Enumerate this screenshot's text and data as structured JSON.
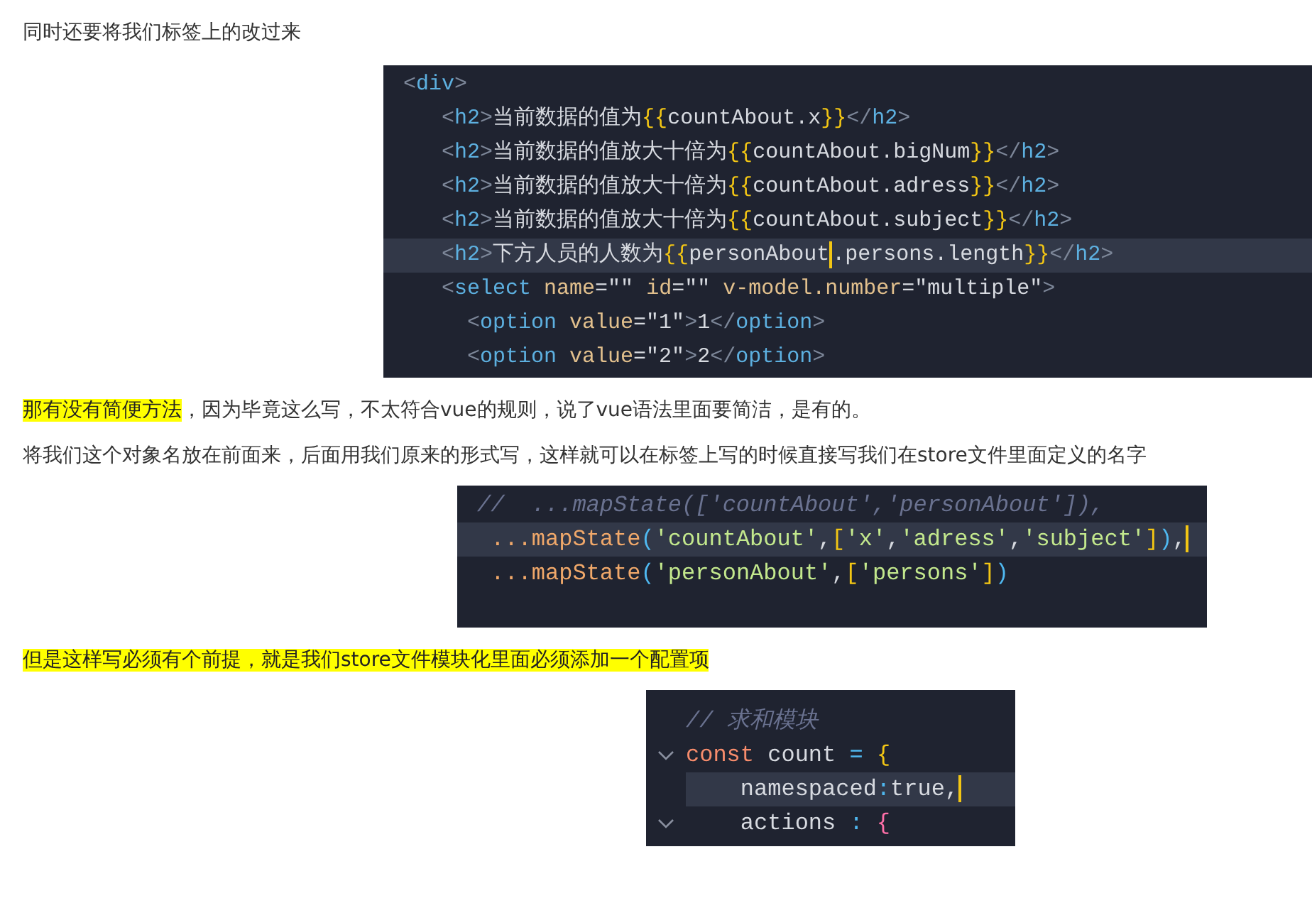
{
  "blocks": [
    {
      "kind": "paragraph",
      "segments": [
        {
          "text": "同时还要将我们标签上的改过来",
          "highlight": false
        }
      ]
    },
    {
      "kind": "code",
      "lines": [
        {
          "current": false,
          "tokens": [
            {
              "t": "<",
              "kind": "punct"
            },
            {
              "t": "div",
              "kind": "tag"
            },
            {
              "t": ">",
              "kind": "punct"
            }
          ]
        },
        {
          "current": false,
          "tokens": [
            {
              "t": "   <",
              "kind": "punct"
            },
            {
              "t": "h2",
              "kind": "tag"
            },
            {
              "t": ">",
              "kind": "punct"
            },
            {
              "t": "当前数据的值为",
              "kind": "text"
            },
            {
              "t": "{{",
              "kind": "brace"
            },
            {
              "t": "countAbout.x",
              "kind": "text"
            },
            {
              "t": "}}",
              "kind": "brace"
            },
            {
              "t": "</",
              "kind": "punct"
            },
            {
              "t": "h2",
              "kind": "tag"
            },
            {
              "t": ">",
              "kind": "punct"
            }
          ]
        },
        {
          "current": false,
          "tokens": [
            {
              "t": "   <",
              "kind": "punct"
            },
            {
              "t": "h2",
              "kind": "tag"
            },
            {
              "t": ">",
              "kind": "punct"
            },
            {
              "t": "当前数据的值放大十倍为",
              "kind": "text"
            },
            {
              "t": "{{",
              "kind": "brace"
            },
            {
              "t": "countAbout.bigNum",
              "kind": "text"
            },
            {
              "t": "}}",
              "kind": "brace"
            },
            {
              "t": "</",
              "kind": "punct"
            },
            {
              "t": "h2",
              "kind": "tag"
            },
            {
              "t": ">",
              "kind": "punct"
            }
          ]
        },
        {
          "current": false,
          "tokens": [
            {
              "t": "   <",
              "kind": "punct"
            },
            {
              "t": "h2",
              "kind": "tag"
            },
            {
              "t": ">",
              "kind": "punct"
            },
            {
              "t": "当前数据的值放大十倍为",
              "kind": "text"
            },
            {
              "t": "{{",
              "kind": "brace"
            },
            {
              "t": "countAbout.adress",
              "kind": "text"
            },
            {
              "t": "}}",
              "kind": "brace"
            },
            {
              "t": "</",
              "kind": "punct"
            },
            {
              "t": "h2",
              "kind": "tag"
            },
            {
              "t": ">",
              "kind": "punct"
            }
          ]
        },
        {
          "current": false,
          "tokens": [
            {
              "t": "   <",
              "kind": "punct"
            },
            {
              "t": "h2",
              "kind": "tag"
            },
            {
              "t": ">",
              "kind": "punct"
            },
            {
              "t": "当前数据的值放大十倍为",
              "kind": "text"
            },
            {
              "t": "{{",
              "kind": "brace"
            },
            {
              "t": "countAbout.subject",
              "kind": "text"
            },
            {
              "t": "}}",
              "kind": "brace"
            },
            {
              "t": "</",
              "kind": "punct"
            },
            {
              "t": "h2",
              "kind": "tag"
            },
            {
              "t": ">",
              "kind": "punct"
            }
          ]
        },
        {
          "current": true,
          "tokens": [
            {
              "t": "   <",
              "kind": "punct"
            },
            {
              "t": "h2",
              "kind": "tag"
            },
            {
              "t": ">",
              "kind": "punct"
            },
            {
              "t": "下方人员的人数为",
              "kind": "text"
            },
            {
              "t": "{{",
              "kind": "brace"
            },
            {
              "t": "personAbout",
              "kind": "text"
            },
            {
              "kind": "cursor"
            },
            {
              "t": ".persons.length",
              "kind": "text"
            },
            {
              "t": "}}",
              "kind": "brace"
            },
            {
              "t": "</",
              "kind": "punct"
            },
            {
              "t": "h2",
              "kind": "tag"
            },
            {
              "t": ">",
              "kind": "punct"
            }
          ]
        },
        {
          "current": false,
          "tokens": [
            {
              "t": "   <",
              "kind": "punct"
            },
            {
              "t": "select",
              "kind": "tag"
            },
            {
              "t": " name",
              "kind": "attr"
            },
            {
              "t": "=\"\"",
              "kind": "text"
            },
            {
              "t": " id",
              "kind": "attr"
            },
            {
              "t": "=\"\"",
              "kind": "text"
            },
            {
              "t": " v-model.number",
              "kind": "attr"
            },
            {
              "t": "=\"multiple\"",
              "kind": "text"
            },
            {
              "t": ">",
              "kind": "punct"
            }
          ]
        },
        {
          "current": false,
          "tokens": [
            {
              "t": "     <",
              "kind": "punct"
            },
            {
              "t": "option",
              "kind": "tag"
            },
            {
              "t": " value",
              "kind": "attr"
            },
            {
              "t": "=\"1\"",
              "kind": "text"
            },
            {
              "t": ">",
              "kind": "punct"
            },
            {
              "t": "1",
              "kind": "text"
            },
            {
              "t": "</",
              "kind": "punct"
            },
            {
              "t": "option",
              "kind": "tag"
            },
            {
              "t": ">",
              "kind": "punct"
            }
          ]
        },
        {
          "current": false,
          "tokens": [
            {
              "t": "     <",
              "kind": "punct"
            },
            {
              "t": "option",
              "kind": "tag"
            },
            {
              "t": " value",
              "kind": "attr"
            },
            {
              "t": "=\"2\"",
              "kind": "text"
            },
            {
              "t": ">",
              "kind": "punct"
            },
            {
              "t": "2",
              "kind": "text"
            },
            {
              "t": "</",
              "kind": "punct"
            },
            {
              "t": "option",
              "kind": "tag"
            },
            {
              "t": ">",
              "kind": "punct"
            }
          ]
        }
      ]
    },
    {
      "kind": "paragraph",
      "segments": [
        {
          "text": "那有没有简便方法",
          "highlight": true
        },
        {
          "text": "，因为毕竟这么写，不太符合vue的规则，说了vue语法里面要简洁，是有的。",
          "highlight": false
        }
      ]
    },
    {
      "kind": "paragraph",
      "segments": [
        {
          "text": "将我们这个对象名放在前面来，后面用我们原来的形式写，这样就可以在标签上写的时候直接写我们在store文件里面定义的名字",
          "highlight": false
        }
      ]
    },
    {
      "kind": "code",
      "lines": [
        {
          "current": false,
          "tokens": [
            {
              "t": "//  ...mapState(['countAbout','personAbout']),",
              "kind": "comment"
            }
          ]
        },
        {
          "current": true,
          "tokens": [
            {
              "t": " ...mapState",
              "kind": "fn"
            },
            {
              "t": "(",
              "kind": "paren"
            },
            {
              "t": "'countAbout'",
              "kind": "str"
            },
            {
              "t": ",",
              "kind": "text"
            },
            {
              "t": "[",
              "kind": "brace"
            },
            {
              "t": "'x'",
              "kind": "str"
            },
            {
              "t": ",",
              "kind": "text"
            },
            {
              "t": "'adress'",
              "kind": "str"
            },
            {
              "t": ",",
              "kind": "text"
            },
            {
              "t": "'subject'",
              "kind": "str"
            },
            {
              "t": "]",
              "kind": "brace"
            },
            {
              "t": ")",
              "kind": "paren"
            },
            {
              "t": ",",
              "kind": "text"
            },
            {
              "kind": "cursor"
            }
          ]
        },
        {
          "current": false,
          "tokens": [
            {
              "t": " ...mapState",
              "kind": "fn"
            },
            {
              "t": "(",
              "kind": "paren"
            },
            {
              "t": "'personAbout'",
              "kind": "str"
            },
            {
              "t": ",",
              "kind": "text"
            },
            {
              "t": "[",
              "kind": "brace"
            },
            {
              "t": "'persons'",
              "kind": "str"
            },
            {
              "t": "]",
              "kind": "brace"
            },
            {
              "t": ")",
              "kind": "paren"
            }
          ]
        }
      ]
    },
    {
      "kind": "paragraph",
      "segments": [
        {
          "text": "但是这样写必须有个前提，就是我们store文件模块化里面必须添加一个配置项",
          "highlight": true
        }
      ]
    },
    {
      "kind": "code",
      "lines": [
        {
          "current": false,
          "fold": false,
          "tokens": [
            {
              "t": "// 求和模块",
              "kind": "comment"
            }
          ]
        },
        {
          "current": false,
          "fold": true,
          "tokens": [
            {
              "t": "const",
              "kind": "keyword"
            },
            {
              "t": " count ",
              "kind": "text"
            },
            {
              "t": "=",
              "kind": "paren"
            },
            {
              "t": " {",
              "kind": "brace"
            }
          ]
        },
        {
          "current": true,
          "fold": false,
          "tokens": [
            {
              "t": "    namespaced",
              "kind": "text"
            },
            {
              "t": ":",
              "kind": "paren"
            },
            {
              "t": "true,",
              "kind": "text"
            },
            {
              "kind": "cursor"
            }
          ]
        },
        {
          "current": false,
          "fold": true,
          "tokens": [
            {
              "t": "    actions ",
              "kind": "text"
            },
            {
              "t": ":",
              "kind": "paren"
            },
            {
              "t": " {",
              "kind": "bool"
            }
          ]
        }
      ]
    }
  ]
}
